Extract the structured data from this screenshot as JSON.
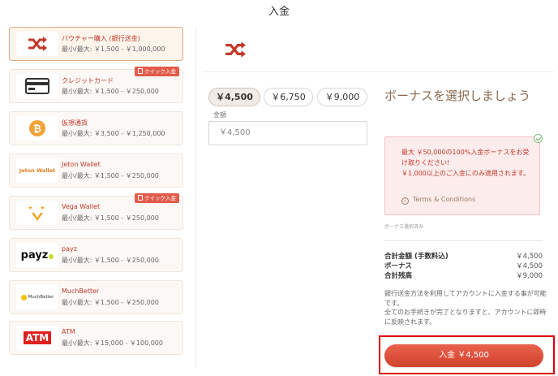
{
  "page": {
    "title": "入金"
  },
  "methods": [
    {
      "name": "バウチャー購入 (銀行送金)",
      "range": "最小/最大: ￥1,500 - ￥1,000,000",
      "icon": "shuffle-icon",
      "selected": true,
      "quick": false
    },
    {
      "name": "クレジットカード",
      "range": "最小/最大: ￥1,500 - ￥250,000",
      "icon": "credit-card-icon",
      "selected": false,
      "quick": true
    },
    {
      "name": "仮想通貨",
      "range": "最小/最大: ￥3,500 - ￥1,250,000",
      "icon": "bitcoin-icon",
      "selected": false,
      "quick": false
    },
    {
      "name": "Jeton Wallet",
      "range": "最小/最大: ￥1,500 - ￥250,000",
      "icon": "jeton-logo",
      "logo_text": "Jeton Wallet",
      "selected": false,
      "quick": false
    },
    {
      "name": "Vega Wallet",
      "range": "最小/最大: ￥1,500 - ￥250,000",
      "icon": "vega-logo",
      "selected": false,
      "quick": true
    },
    {
      "name": "payz",
      "range": "最小/最大: ￥1,500 - ￥250,000",
      "icon": "payz-logo",
      "logo_text": "payz",
      "selected": false,
      "quick": false
    },
    {
      "name": "MuchBetter",
      "range": "最小/最大: ￥1,500 - ￥250,000",
      "icon": "muchbetter-logo",
      "logo_text": "MuchBetter",
      "selected": false,
      "quick": false
    },
    {
      "name": "ATM",
      "range": "最小/最大: ￥15,000 - ￥100,000",
      "icon": "atm-logo",
      "logo_text": "ATM",
      "selected": false,
      "quick": false
    }
  ],
  "quick_badge": "クイック入金",
  "amount": {
    "chips": [
      "￥4,500",
      "￥6,750",
      "￥9,000"
    ],
    "active_index": 0,
    "label": "金額",
    "input_value": "￥4,500"
  },
  "bonus": {
    "title": "ボーナスを選択しましょう",
    "lines": [
      "最大 ￥50,000の100%入金ボーナスをお受け取りください!",
      "￥1,000以上のご入金にのみ適用されます。"
    ],
    "terms": "Terms & Conditions",
    "note": "ボーナス選択済み"
  },
  "summary": [
    {
      "label": "合計金額 (手数料込)",
      "value": "￥4,500"
    },
    {
      "label": "ボーナス",
      "value": "￥4,500"
    },
    {
      "label": "合計残高",
      "value": "￥9,000"
    }
  ],
  "notice": {
    "line1": "銀行送金方法を利用してアカウントに入金する事が可能です。",
    "line2": "全てのお手続きが完了となりますと、アカウントに即時に反映されます。"
  },
  "deposit_button": "入金 ￥4,500",
  "colors": {
    "accent": "#d9442f",
    "brown": "#8a6a4f",
    "highlight_frame": "#d9000c"
  }
}
